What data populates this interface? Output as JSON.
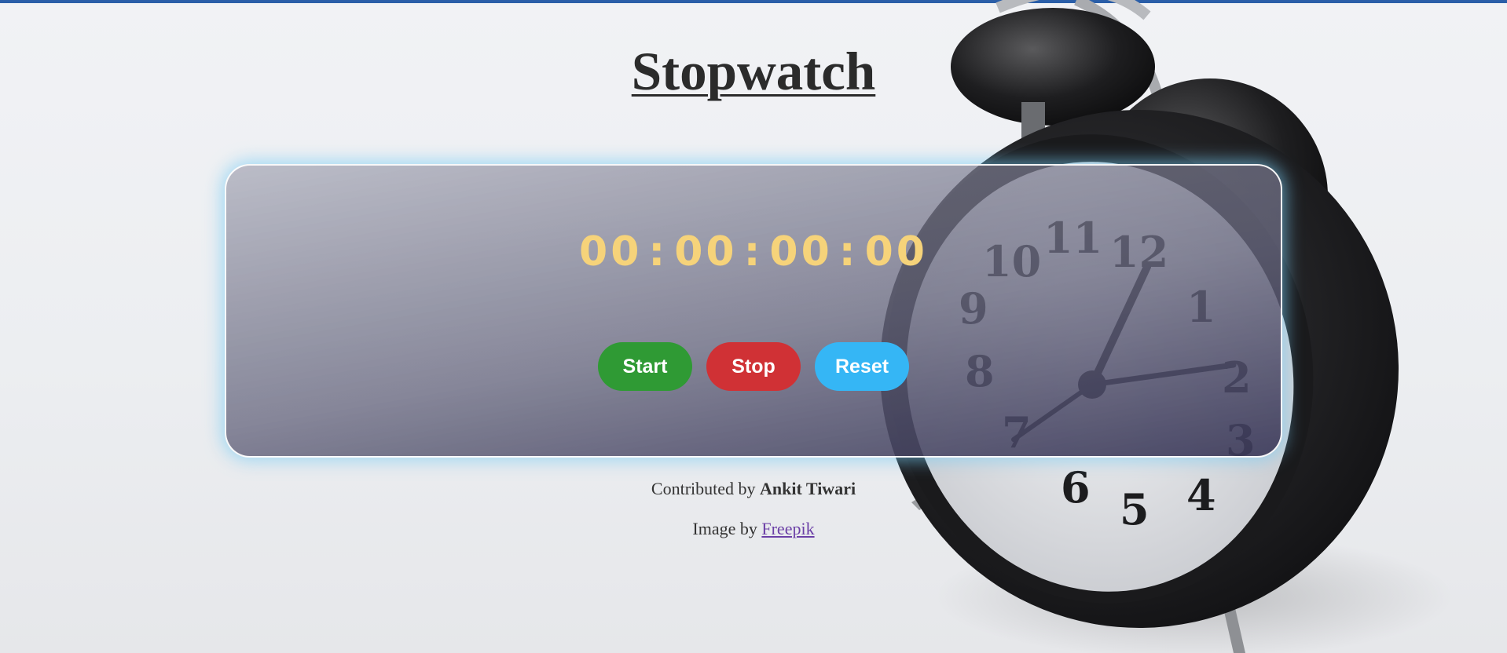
{
  "page": {
    "title": "Stopwatch"
  },
  "timer": {
    "hours": "00",
    "minutes": "00",
    "seconds": "00",
    "centiseconds": "00",
    "separator": ":"
  },
  "controls": {
    "start_label": "Start",
    "stop_label": "Stop",
    "reset_label": "Reset"
  },
  "footer": {
    "contributed_prefix": "Contributed by ",
    "contributor_name": "Ankit Tiwari",
    "image_prefix": "Image by ",
    "image_source_link": "Freepik"
  },
  "colors": {
    "timer_digits": "#f6d37a",
    "start_button": "#2f9a34",
    "stop_button": "#d03135",
    "reset_button": "#35b6f5",
    "panel_glow": "#78cdf5",
    "link": "#6b3fa6"
  },
  "icons": {
    "background_image": "alarm-clock-photo"
  }
}
